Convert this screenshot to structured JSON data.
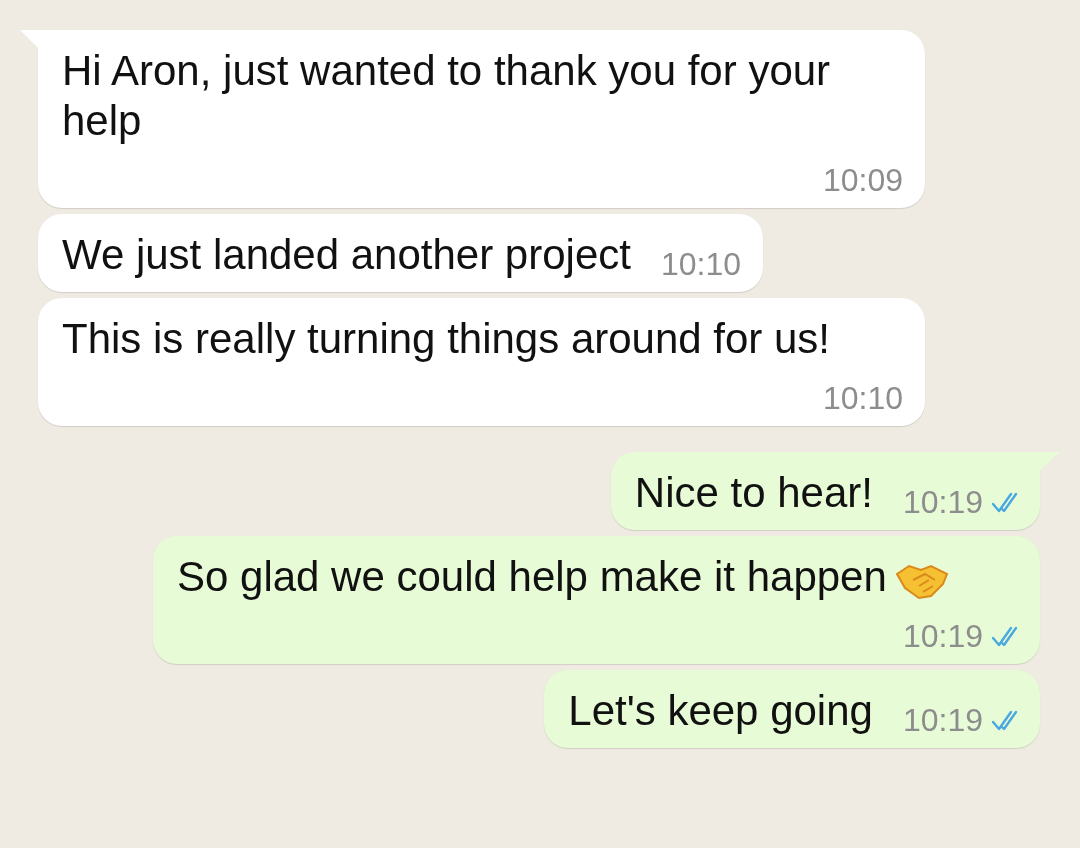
{
  "messages": [
    {
      "kind": "incoming",
      "tail": true,
      "text": "Hi Aron, just wanted to thank you for your help",
      "time": "10:09"
    },
    {
      "kind": "incoming",
      "tail": false,
      "text": "We just landed another project",
      "time": "10:10"
    },
    {
      "kind": "incoming",
      "tail": false,
      "text": "This is really turning things around for us!",
      "time": "10:10"
    },
    {
      "kind": "outgoing",
      "tail": true,
      "text": "Nice to hear!",
      "time": "10:19",
      "read": true
    },
    {
      "kind": "outgoing",
      "tail": false,
      "text": "So glad we could help make it happen",
      "trailing_icon": true,
      "time": "10:19",
      "read": true
    },
    {
      "kind": "outgoing",
      "tail": false,
      "text": "Let's keep going",
      "time": "10:19",
      "read": true
    }
  ]
}
